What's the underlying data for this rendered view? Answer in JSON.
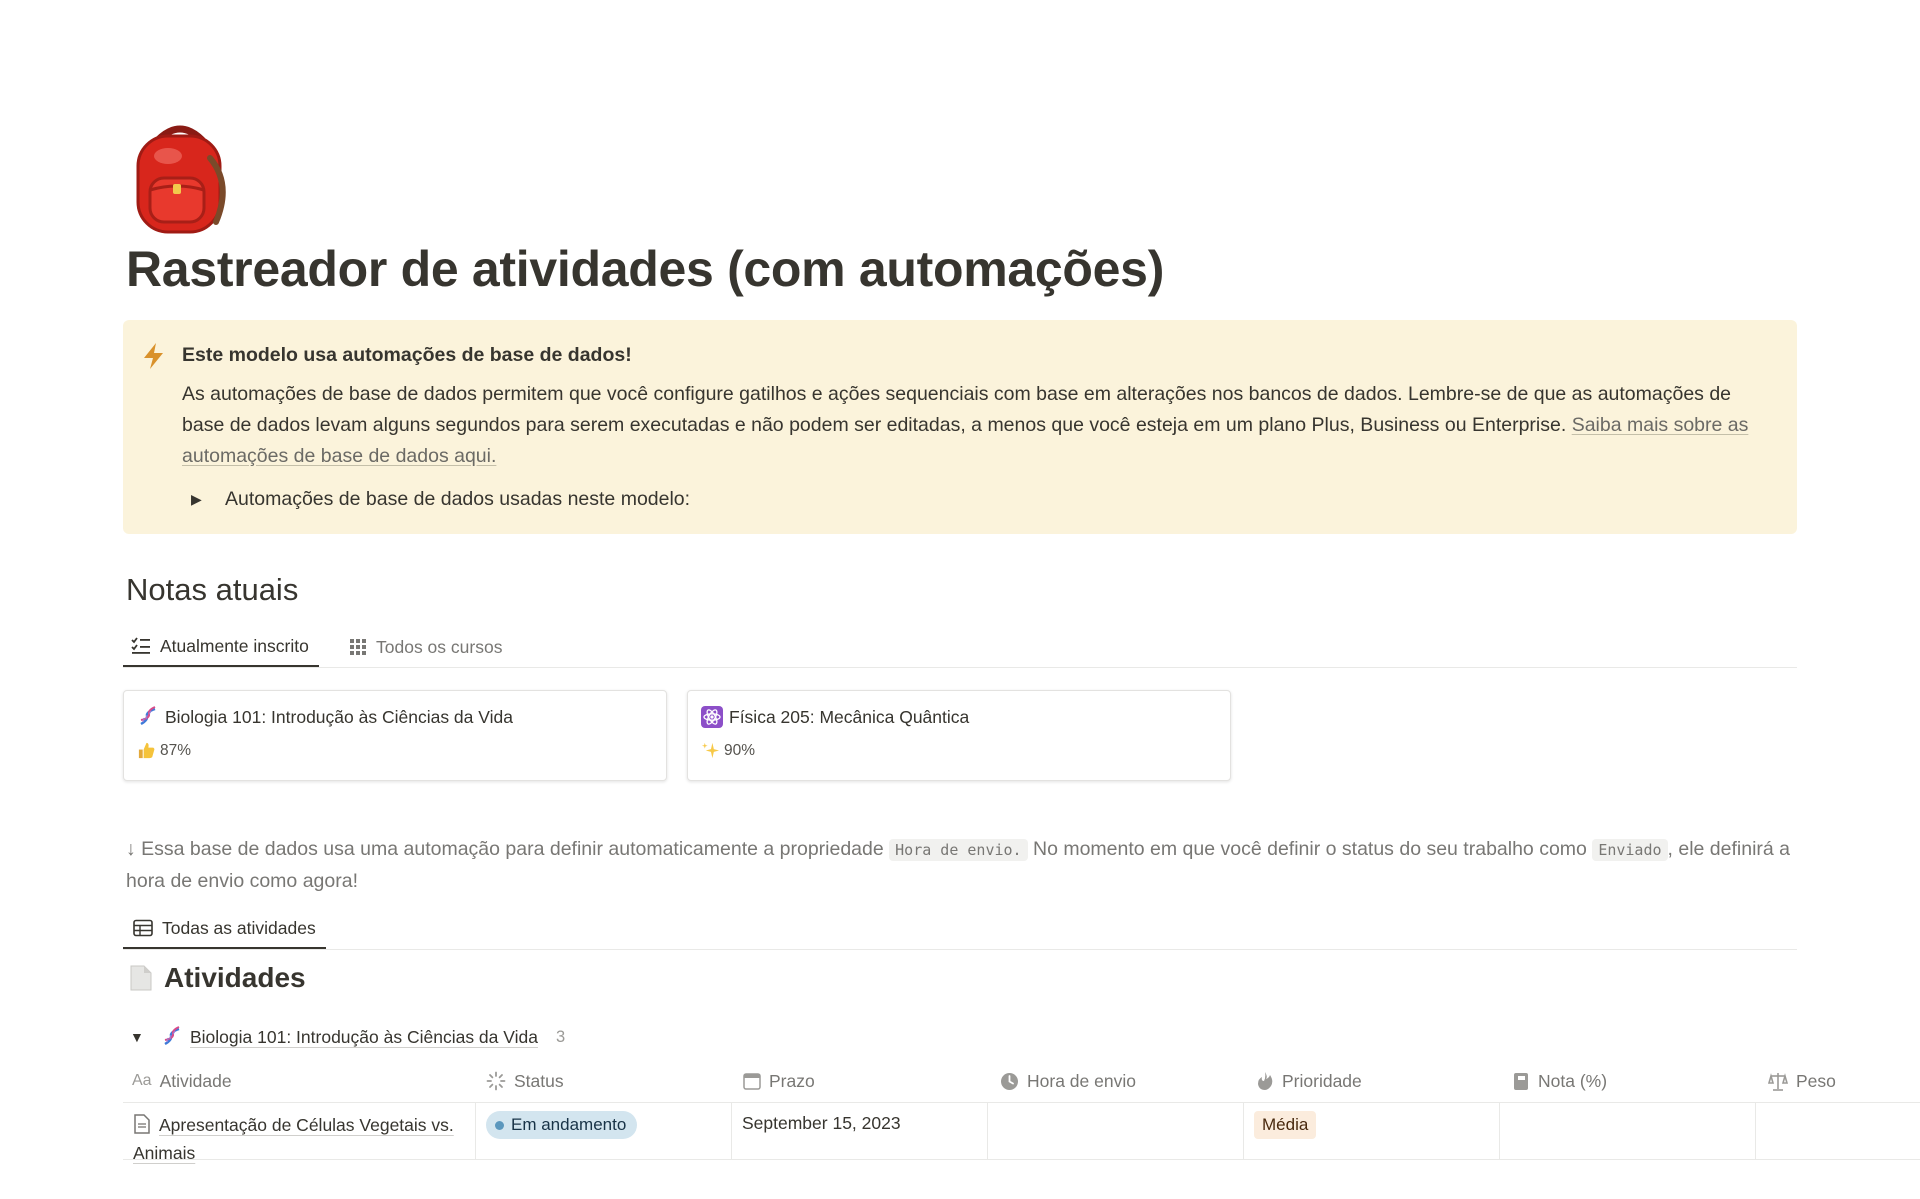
{
  "page": {
    "icon": "backpack-icon",
    "title": "Rastreador de atividades (com automações)"
  },
  "callout": {
    "icon": "lightning-icon",
    "title": "Este modelo usa automações de base de dados!",
    "body": "As automações de base de dados permitem que você configure gatilhos e ações sequenciais com base em alterações nos bancos de dados. Lembre-se de que as automações de base de dados levam alguns segundos para serem executadas e não podem ser editadas, a menos que você esteja em um plano Plus, Business ou Enterprise.",
    "link": "Saiba mais sobre as automações de base de dados aqui.",
    "toggle": "Automações de base de dados usadas neste modelo:"
  },
  "grades": {
    "heading": "Notas atuais",
    "tabs": [
      {
        "label": "Atualmente inscrito",
        "icon": "checklist-icon",
        "active": true
      },
      {
        "label": "Todos os cursos",
        "icon": "grid-icon",
        "active": false
      }
    ],
    "cards": [
      {
        "title": "Biologia 101: Introdução às Ciências da Vida",
        "icon": "dna-icon",
        "grade": "87%",
        "grade_icon": "thumbs-up-icon"
      },
      {
        "title": "Física 205: Mecânica Quântica",
        "icon": "atom-icon",
        "grade": "90%",
        "grade_icon": "sparkles-icon"
      }
    ]
  },
  "note": {
    "prefix": "↓ Essa base de dados usa uma automação para definir automaticamente a propriedade ",
    "code1": "Hora de envio.",
    "middle": " No momento em que você definir o status do seu trabalho como ",
    "code2": "Enviado",
    "suffix": ", ele definirá a hora de envio como agora!"
  },
  "activities": {
    "tab": "Todas as atividades",
    "title": "Atividades",
    "group": {
      "name": "Biologia 101: Introdução às Ciências da Vida",
      "count": "3"
    },
    "columns": [
      {
        "label": "Atividade",
        "icon": "text-aa-icon"
      },
      {
        "label": "Status",
        "icon": "status-icon"
      },
      {
        "label": "Prazo",
        "icon": "calendar-icon"
      },
      {
        "label": "Hora de envio",
        "icon": "clock-icon"
      },
      {
        "label": "Prioridade",
        "icon": "fire-icon"
      },
      {
        "label": "Nota (%)",
        "icon": "notebook-icon"
      },
      {
        "label": "Peso",
        "icon": "scale-icon"
      }
    ],
    "rows": [
      {
        "activity": "Apresentação de Células Vegetais vs. Animais",
        "status": "Em andamento",
        "due": "September 15, 2023",
        "submitted": "",
        "priority": "Média",
        "grade": "",
        "weight": ""
      }
    ]
  },
  "colors": {
    "callout_bg": "#fbf3db",
    "status_blue": "#d3e5ef",
    "priority_orange": "#fbecdd",
    "text": "#37352f",
    "muted": "#787774"
  }
}
